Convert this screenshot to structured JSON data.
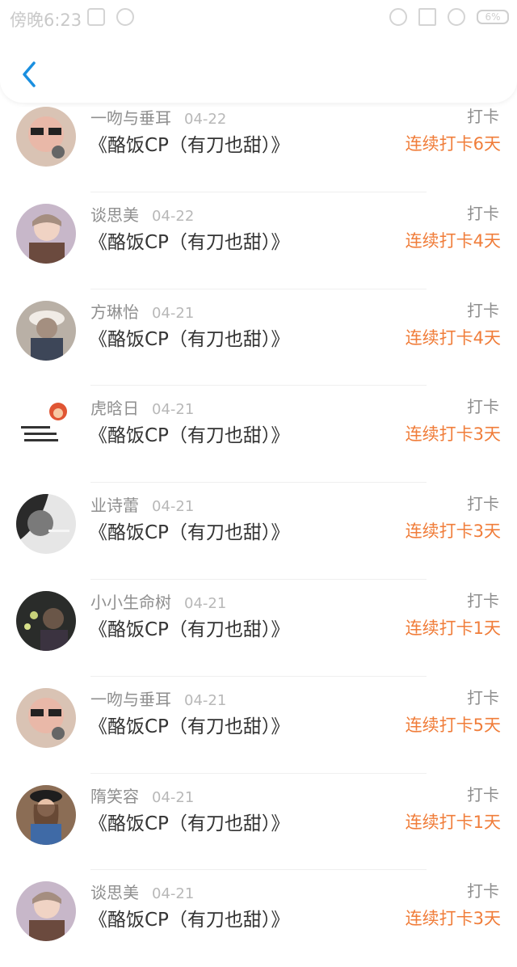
{
  "status_bar": {
    "time": "傍晚6:23",
    "battery": "6%"
  },
  "colors": {
    "streak": "#f07d3a",
    "back": "#1a8fe0"
  },
  "header": {
    "back_icon": "chevron-left-icon"
  },
  "rows": [
    {
      "name": "一吻与垂耳",
      "date": "04-22",
      "book": "《酪饭CP（有刀也甜）》",
      "action": "打卡",
      "streak": "连续打卡6天"
    },
    {
      "name": "谈思美",
      "date": "04-22",
      "book": "《酪饭CP（有刀也甜）》",
      "action": "打卡",
      "streak": "连续打卡4天"
    },
    {
      "name": "方琳怡",
      "date": "04-21",
      "book": "《酪饭CP（有刀也甜）》",
      "action": "打卡",
      "streak": "连续打卡4天"
    },
    {
      "name": "虎晗日",
      "date": "04-21",
      "book": "《酪饭CP（有刀也甜）》",
      "action": "打卡",
      "streak": "连续打卡3天"
    },
    {
      "name": "业诗蕾",
      "date": "04-21",
      "book": "《酪饭CP（有刀也甜）》",
      "action": "打卡",
      "streak": "连续打卡3天"
    },
    {
      "name": "小小生命树",
      "date": "04-21",
      "book": "《酪饭CP（有刀也甜）》",
      "action": "打卡",
      "streak": "连续打卡1天"
    },
    {
      "name": "一吻与垂耳",
      "date": "04-21",
      "book": "《酪饭CP（有刀也甜）》",
      "action": "打卡",
      "streak": "连续打卡5天"
    },
    {
      "name": "隋笑容",
      "date": "04-21",
      "book": "《酪饭CP（有刀也甜）》",
      "action": "打卡",
      "streak": "连续打卡1天"
    },
    {
      "name": "谈思美",
      "date": "04-21",
      "book": "《酪饭CP（有刀也甜）》",
      "action": "打卡",
      "streak": "连续打卡3天"
    }
  ]
}
